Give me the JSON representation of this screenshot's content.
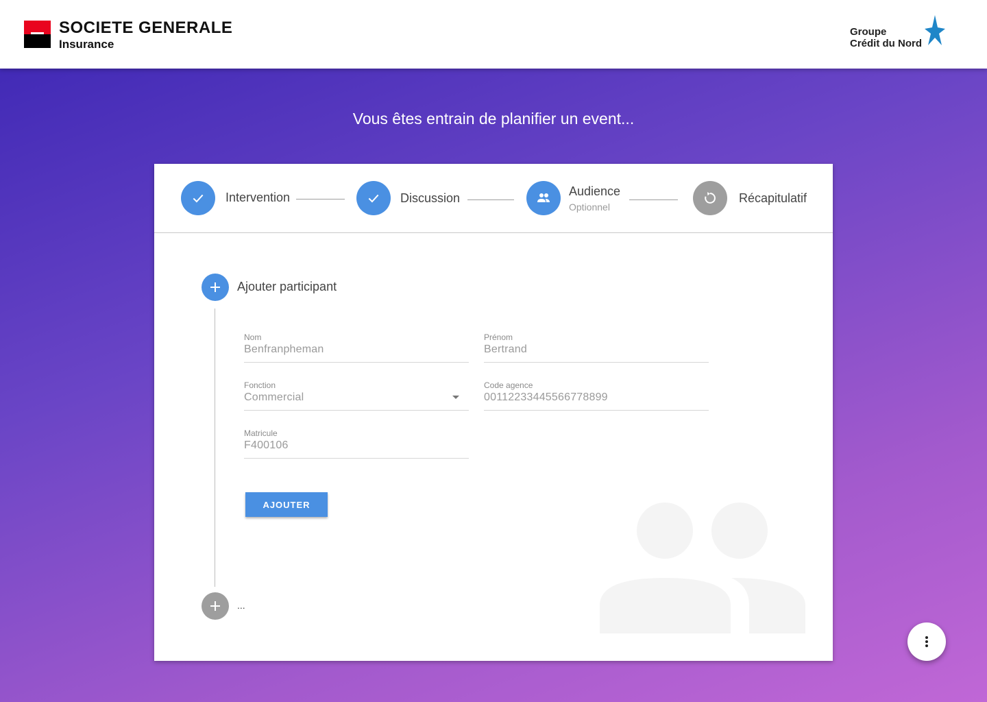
{
  "header": {
    "left_logo": {
      "name": "SOCIETE GENERALE",
      "subtitle": "Insurance"
    },
    "right_logo": {
      "line1": "Groupe",
      "line2": "Crédit du Nord"
    }
  },
  "page_title": "Vous êtes entrain de planifier un event...",
  "stepper": {
    "steps": [
      {
        "label": "Intervention",
        "icon": "check-icon",
        "state": "done"
      },
      {
        "label": "Discussion",
        "icon": "check-icon",
        "state": "done"
      },
      {
        "label": "Audience",
        "sublabel": "Optionnel",
        "icon": "people-icon",
        "state": "active"
      },
      {
        "label": "Récapitulatif",
        "icon": "restore-icon",
        "state": "pending"
      }
    ]
  },
  "participant": {
    "add_label": "Ajouter participant",
    "fields": {
      "nom": {
        "label": "Nom",
        "value": "Benfranpheman"
      },
      "prenom": {
        "label": "Prénom",
        "value": "Bertrand"
      },
      "fonction": {
        "label": "Fonction",
        "value": "Commercial"
      },
      "code_agence": {
        "label": "Code agence",
        "value": "00112233445566778899"
      },
      "matricule": {
        "label": "Matricule",
        "value": "F400106"
      }
    },
    "submit_label": "AJOUTER",
    "more_label": "..."
  },
  "colors": {
    "accent": "#4a90e2",
    "inactive": "#9e9e9e",
    "brand_red": "#e9041e",
    "gradient_start": "#3a25b3",
    "gradient_end": "#c067d6"
  }
}
